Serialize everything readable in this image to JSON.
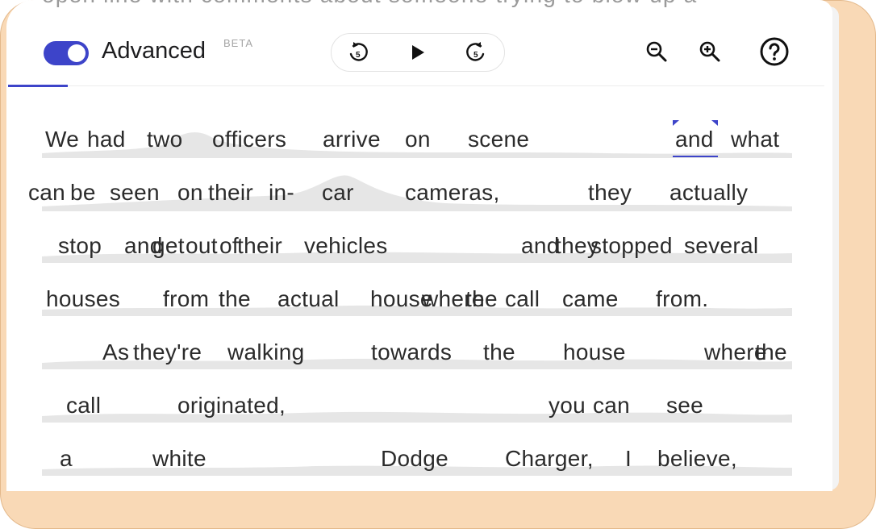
{
  "background_text": "open line with comments about someone trying to blow up a",
  "toolbar": {
    "toggle_label": "Advanced",
    "beta_badge": "BETA",
    "toggle_on": true,
    "accent_color": "#3d44c9",
    "icons": {
      "rewind": "rewind-5-icon",
      "play": "play-icon",
      "forward": "forward-5-icon",
      "zoom_out": "zoom-out-icon",
      "zoom_in": "zoom-in-icon",
      "help": "help-icon"
    }
  },
  "transcript": {
    "words": [
      [
        "We",
        "had",
        "two",
        "officers",
        "arrive",
        "on",
        "scene",
        "and",
        "what"
      ],
      [
        "can",
        "be",
        "seen",
        "on",
        "their",
        "in-",
        "car",
        "cameras,",
        "they",
        "actually"
      ],
      [
        "stop",
        "and",
        "get",
        "out",
        "of",
        "their",
        "vehicles",
        "and",
        "they",
        "stopped",
        "several"
      ],
      [
        "houses",
        "from",
        "the",
        "actual",
        "house",
        "where",
        "the",
        "call",
        "came",
        "from."
      ],
      [
        "As",
        "they're",
        "walking",
        "towards",
        "the",
        "house",
        "where",
        "the"
      ],
      [
        "call",
        "originated,",
        "you",
        "can",
        "see"
      ],
      [
        "a",
        "white",
        "Dodge",
        "Charger,",
        "I",
        "believe,"
      ]
    ],
    "selected_word": "and"
  }
}
